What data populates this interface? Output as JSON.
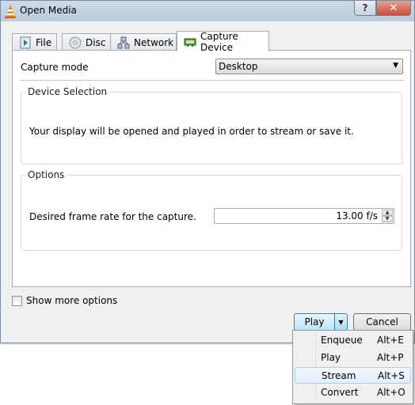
{
  "window": {
    "title": "Open Media",
    "help_label": "?",
    "close_label": "✕"
  },
  "tabs": [
    {
      "label": "File",
      "icon": "file-icon"
    },
    {
      "label": "Disc",
      "icon": "disc-icon"
    },
    {
      "label": "Network",
      "icon": "network-icon"
    },
    {
      "label": "Capture Device",
      "icon": "capture-device-icon",
      "active": true
    }
  ],
  "capture": {
    "mode_label": "Capture mode",
    "mode_value": "Desktop",
    "device_selection": {
      "title": "Device Selection",
      "text": "Your display will be opened and played in order to stream or save it."
    },
    "options": {
      "title": "Options",
      "frame_rate_label": "Desired frame rate for the capture.",
      "frame_rate_value": "13.00 f/s"
    }
  },
  "footer": {
    "show_more_label": "Show more options",
    "show_more_checked": false,
    "play_label": "Play",
    "cancel_label": "Cancel"
  },
  "play_menu": {
    "items": [
      {
        "label": "Enqueue",
        "accel": "Alt+E"
      },
      {
        "label": "Play",
        "accel": "Alt+P"
      },
      {
        "label": "Stream",
        "accel": "Alt+S",
        "highlighted": true
      },
      {
        "label": "Convert",
        "accel": "Alt+O"
      }
    ]
  },
  "colors": {
    "accent": "#3c7fb1",
    "menu_highlight": "#e2eef9",
    "vlc_orange": "#f08a00"
  }
}
